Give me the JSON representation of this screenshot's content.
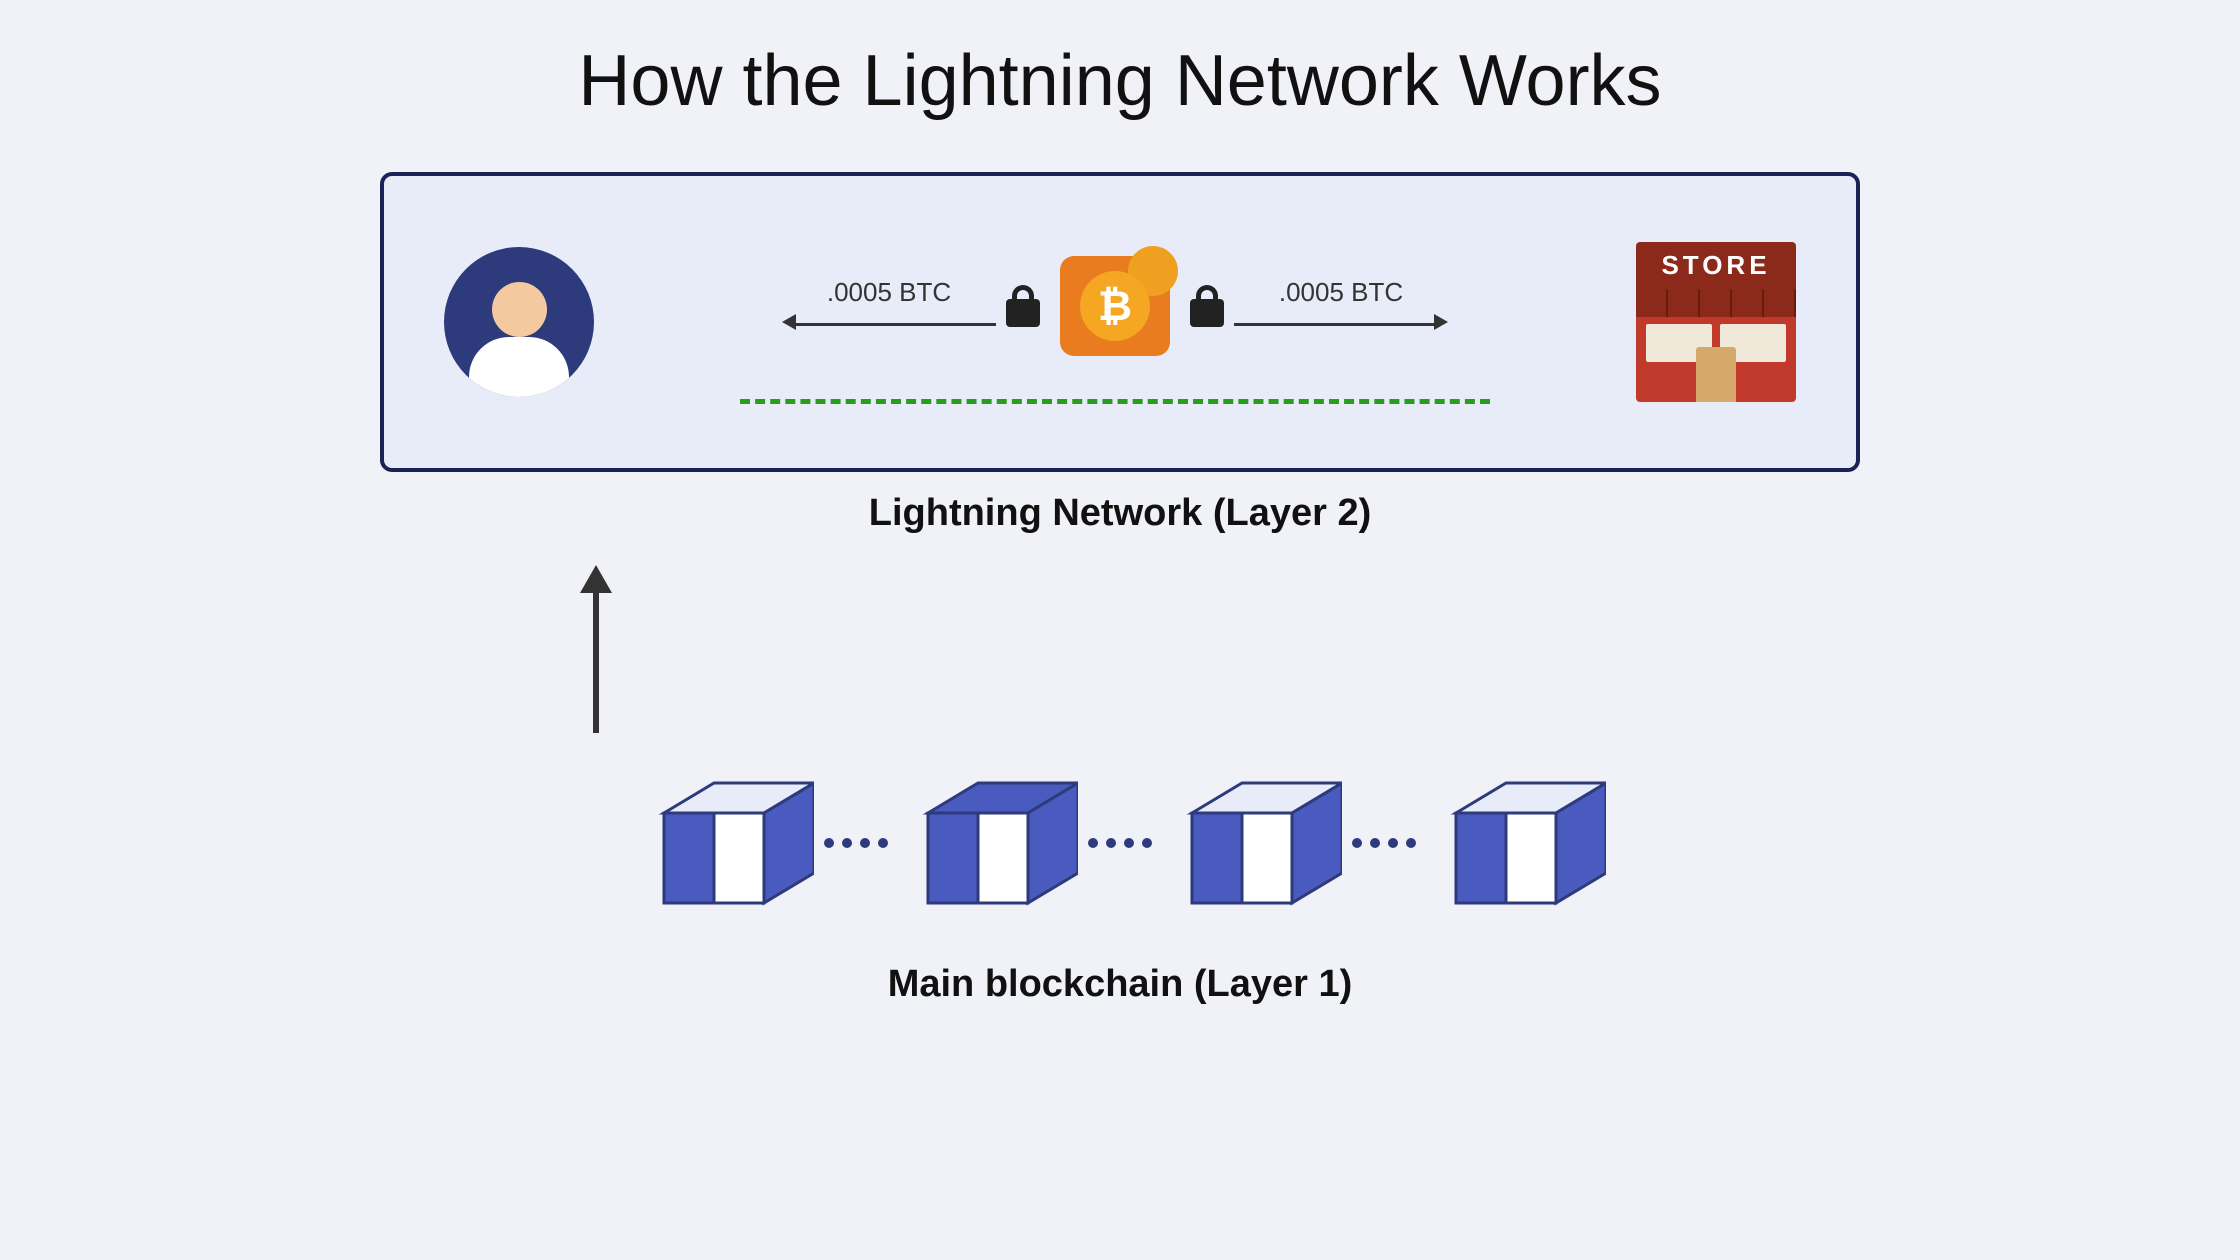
{
  "page": {
    "title": "How the Lightning Network Works",
    "background_color": "#f0f2f8"
  },
  "lightning_section": {
    "box_bg": "#e8ecf8",
    "box_border": "#1a2356",
    "left_btc_label": ".0005 BTC",
    "right_btc_label": ".0005 BTC",
    "dashed_line_color": "#2a9d1e",
    "label": "Lightning Network (Layer 2)",
    "store_sign": "STORE"
  },
  "blockchain_section": {
    "label": "Main blockchain (Layer 1)",
    "block_count": 4
  }
}
